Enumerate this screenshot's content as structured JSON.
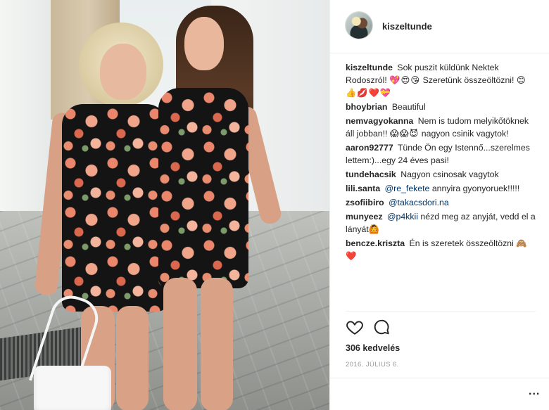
{
  "post": {
    "username": "kiszeltunde",
    "likes": "306 kedvelés",
    "date": "2016. JÚLIUS 6.",
    "more_label": "..."
  },
  "icons": {
    "like": "heart-outline-icon",
    "comment": "speech-bubble-icon",
    "more": "more-options-icon"
  },
  "comments": [
    {
      "user": "kiszeltunde",
      "text": "Sok puszit küldünk Nektek Rodoszról!",
      "emojis_1": "💖😍😘",
      "text2": "Szeretünk összeöltözni!",
      "emojis_2": "😊👍💋❤️💝"
    },
    {
      "user": "bhoybrian",
      "text": "Beautiful"
    },
    {
      "user": "nemvagyokanna",
      "text": "Nem is tudom melyikőtöknek áll jobban!!",
      "emojis": "😱😱😈",
      "text2": "nagyon csinik vagytok!"
    },
    {
      "user": "aaron92777",
      "text": "Tünde Ön egy Istennő...szerelmes lettem:)...egy 24 éves pasi!"
    },
    {
      "user": "tundehacsik",
      "text": "Nagyon csinosak vagytok"
    },
    {
      "user": "lili.santa",
      "mention": "@re_fekete",
      "text": "annyira gyonyoruek!!!!!"
    },
    {
      "user": "zsofiibiro",
      "mention": "@takacsdori.na"
    },
    {
      "user": "munyeez",
      "mention": "@p4kkii",
      "text": "nézd meg az anyját, vedd el a lányát",
      "emojis": "🙆"
    },
    {
      "user": "bencze.kriszta",
      "text": "Én is szeretek összeöltözni",
      "emojis": "🙈❤️"
    }
  ]
}
